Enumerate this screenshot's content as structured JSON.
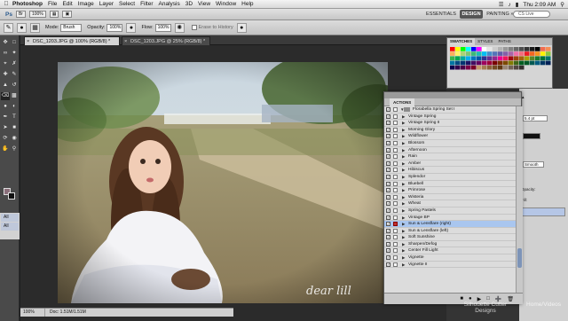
{
  "menubar": {
    "apple": "",
    "app": "Photoshop",
    "items": [
      "File",
      "Edit",
      "Image",
      "Layer",
      "Select",
      "Filter",
      "Analysis",
      "3D",
      "View",
      "Window",
      "Help"
    ],
    "clock": "Thu 2:09 AM"
  },
  "appbar": {
    "ps_label": "Ps",
    "zoom": "100%",
    "workspaces": [
      "ESSENTIALS",
      "DESIGN",
      "PAINTING"
    ],
    "workspace_more": "»",
    "cs_live": "CS Live"
  },
  "options": {
    "mode_label": "Mode:",
    "mode_value": "Brush",
    "opacity_label": "Opacity:",
    "opacity_value": "100%",
    "flow_label": "Flow:",
    "flow_value": "100%",
    "erase_to_history": "Erase to History"
  },
  "tabs": [
    {
      "label": "DSC_1203.JPG @ 100% (RGB/8) *"
    },
    {
      "label": "DSC_1203.JPG @ 25% (RGB/8) *"
    }
  ],
  "status": {
    "zoom": "100%",
    "doc_info": "Doc: 1.51M/1.51M"
  },
  "photo": {
    "signature": "dear lill"
  },
  "swatches_panel": {
    "tabs": [
      "SWATCHES",
      "STYLES",
      "PATHS"
    ],
    "colors": [
      "#ff0000",
      "#ffff00",
      "#00ff00",
      "#00ffff",
      "#0000ff",
      "#ff00ff",
      "#ffffff",
      "#e6e6e6",
      "#cccccc",
      "#b3b3b3",
      "#999999",
      "#808080",
      "#666666",
      "#4d4d4d",
      "#333333",
      "#1a1a1a",
      "#000000",
      "#f26c4f",
      "#f68e55",
      "#fbaf5c",
      "#fff467",
      "#acd372",
      "#7cc576",
      "#3bb878",
      "#1abbb4",
      "#00bff3",
      "#438ccb",
      "#5574b9",
      "#605ca8",
      "#855fa8",
      "#a763a8",
      "#f06ea9",
      "#f26d7d",
      "#ed1c24",
      "#f26522",
      "#f7941d",
      "#fff200",
      "#8dc73f",
      "#39b54a",
      "#00a651",
      "#00a99d",
      "#00aeef",
      "#0072bc",
      "#0054a6",
      "#2e3192",
      "#662d91",
      "#92278f",
      "#ec008c",
      "#ed145b",
      "#9e0b0f",
      "#a0410d",
      "#a36209",
      "#aba000",
      "#598527",
      "#197b30",
      "#007236",
      "#00746b",
      "#0076a3",
      "#004a80",
      "#003471",
      "#1b1464",
      "#440e62",
      "#630460",
      "#9e005d",
      "#9e0039",
      "#790000",
      "#7b2e00",
      "#7d4900",
      "#827b00",
      "#406618",
      "#005e20",
      "#005826",
      "#005952",
      "#005b7f",
      "#003663",
      "#002157",
      "#0d004c",
      "#32004b",
      "#4b0049",
      "#7b0046",
      "#7a0026",
      "#c69c6d",
      "#a67c52",
      "#8c6239",
      "#754c24",
      "#603913",
      "#998675",
      "#736357",
      "#534741",
      "#362f2d"
    ]
  },
  "layers_bits": {
    "opacity_label": "Opacity:",
    "fill_label": "Fill:",
    "unit_value": "5.4 pt",
    "smooth_label": "Smooth"
  },
  "actions_panel": {
    "tab": "ACTIONS",
    "set_name": "Florabella Spring Set I",
    "items": [
      "Vintage Spring",
      "Vintage Spring II",
      "Morning Glory",
      "Wildflower",
      "Blossom",
      "Afternoon",
      "Rain",
      "Amber",
      "Hibiscus",
      "Splendor",
      "Bluebell",
      "Primrose",
      "Wisteria",
      "Wheat",
      "Spring Pastels",
      "Vintage BP",
      "Sun & Lensflare (right)",
      "Sun & Lensflare (left)",
      "Soft Sunshine",
      "Sharpen/Defog",
      "Center Fill Light",
      "Vignette",
      "Vignette II"
    ],
    "selected_index": 16
  },
  "watermark": {
    "left": "Silhouette Cutter Designs",
    "right": "Home/Videos"
  },
  "colors": {
    "accent_selected": "#a9c6ef",
    "foreground_swatch": "#8a6e7a",
    "background_swatch": "#111111"
  }
}
